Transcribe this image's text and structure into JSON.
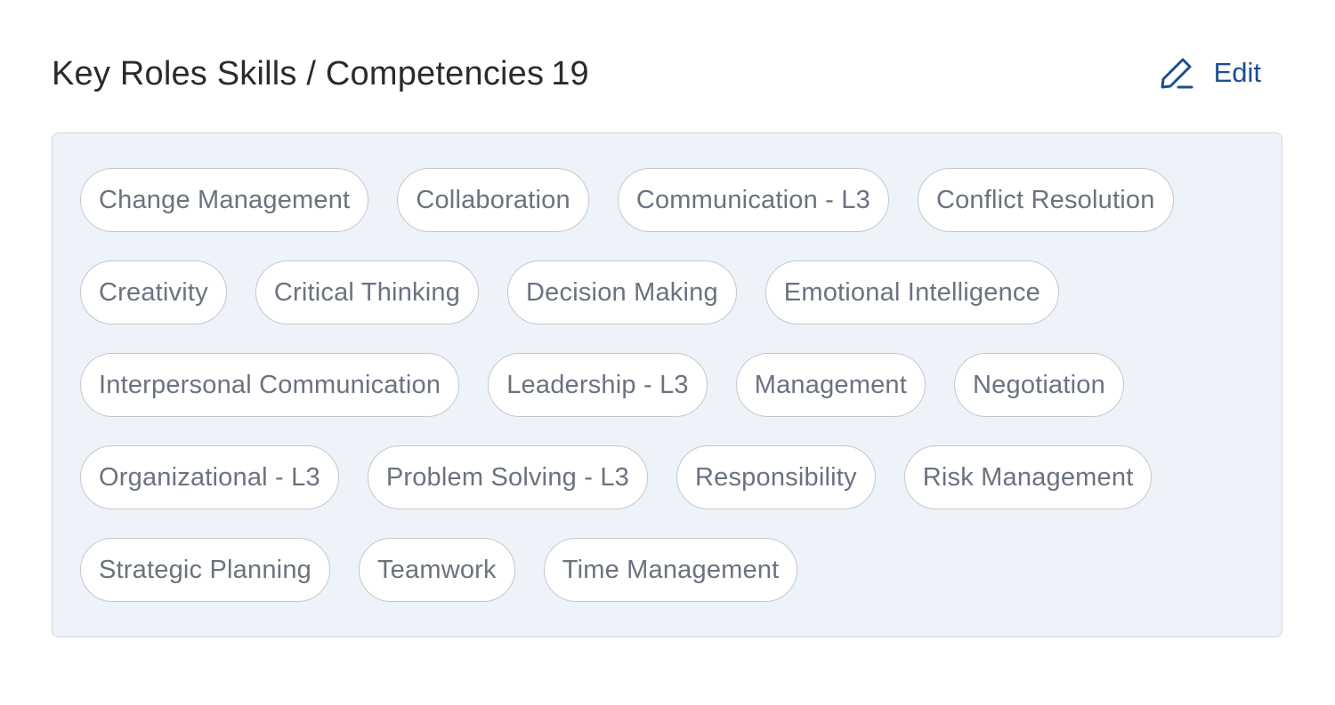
{
  "section": {
    "title": "Key Roles Skills / Competencies",
    "count": "19",
    "edit_label": "Edit",
    "edit_icon": "pencil-icon"
  },
  "chips": [
    "Change Management",
    "Collaboration",
    "Communication - L3",
    "Conflict Resolution",
    "Creativity",
    "Critical Thinking",
    "Decision Making",
    "Emotional Intelligence",
    "Interpersonal Communication",
    "Leadership - L3",
    "Management",
    "Negotiation",
    "Organizational - L3",
    "Problem Solving - L3",
    "Responsibility",
    "Risk Management",
    "Strategic Planning",
    "Teamwork",
    "Time Management"
  ],
  "colors": {
    "title": "#2b2b2b",
    "accent": "#1d4f8c",
    "panel_bg": "#eef3fa",
    "chip_text": "#6b7280"
  }
}
